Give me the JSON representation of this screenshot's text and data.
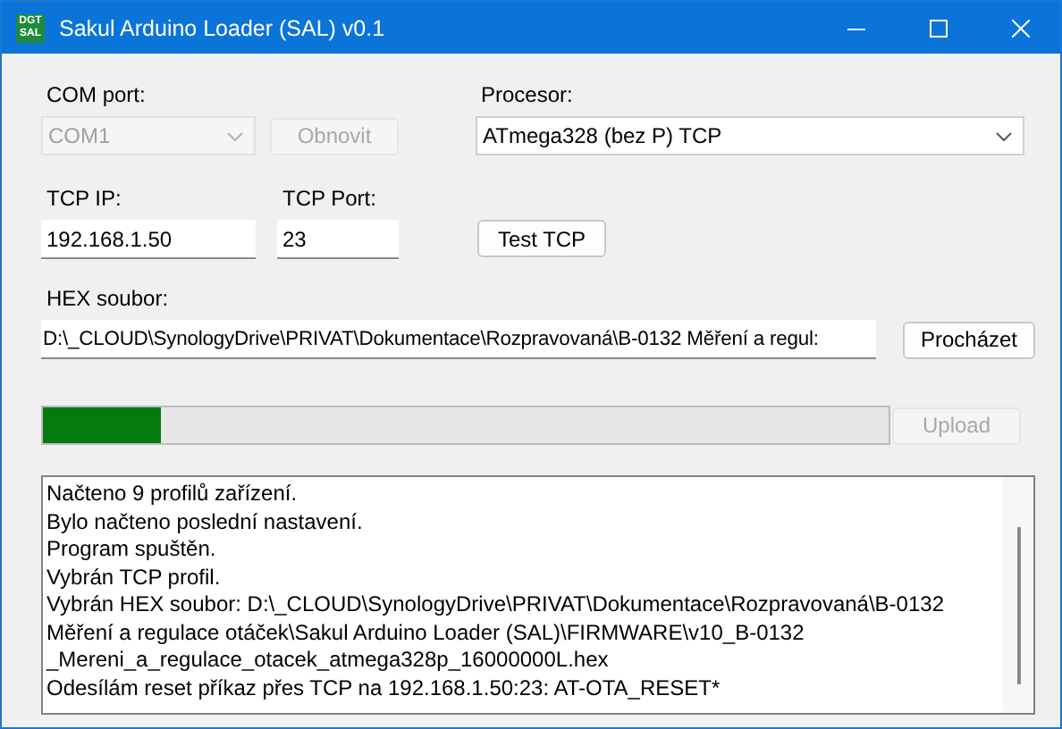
{
  "window": {
    "title": "Sakul Arduino Loader (SAL) v0.1",
    "icon_text": [
      "DGT",
      "SAL"
    ]
  },
  "com_port": {
    "label": "COM port:",
    "value": "COM1",
    "disabled": true
  },
  "refresh_button": {
    "label": "Obnovit",
    "disabled": true
  },
  "processor": {
    "label": "Procesor:",
    "value": "ATmega328 (bez P) TCP",
    "disabled": false
  },
  "tcp_ip": {
    "label": "TCP IP:",
    "value": "192.168.1.50"
  },
  "tcp_port": {
    "label": "TCP Port:",
    "value": "23"
  },
  "test_button": {
    "label": "Test TCP",
    "disabled": false
  },
  "hex_file": {
    "label": "HEX soubor:",
    "value": "D:\\_CLOUD\\SynologyDrive\\PRIVAT\\Dokumentace\\Rozpravovaná\\B-0132 Měření a regul:"
  },
  "browse_button": {
    "label": "Procházet",
    "disabled": false
  },
  "progress": {
    "level": 0.14
  },
  "upload_button": {
    "label": "Upload",
    "disabled": true
  },
  "log": {
    "lines": [
      "Načteno 9 profilů zařízení.",
      "Bylo načteno poslední nastavení.",
      "Program spuštěn.",
      "Vybrán TCP profil.",
      "Vybrán HEX soubor: D:\\_CLOUD\\SynologyDrive\\PRIVAT\\Dokumentace\\Rozpravovaná\\B-0132",
      "Měření a regulace otáček\\Sakul Arduino Loader (SAL)\\FIRMWARE\\v10_B-0132",
      "_Mereni_a_regulace_otacek_atmega328p_16000000L.hex",
      "Odesílám reset příkaz přes TCP na 192.168.1.50:23: AT-OTA_RESET*"
    ]
  }
}
